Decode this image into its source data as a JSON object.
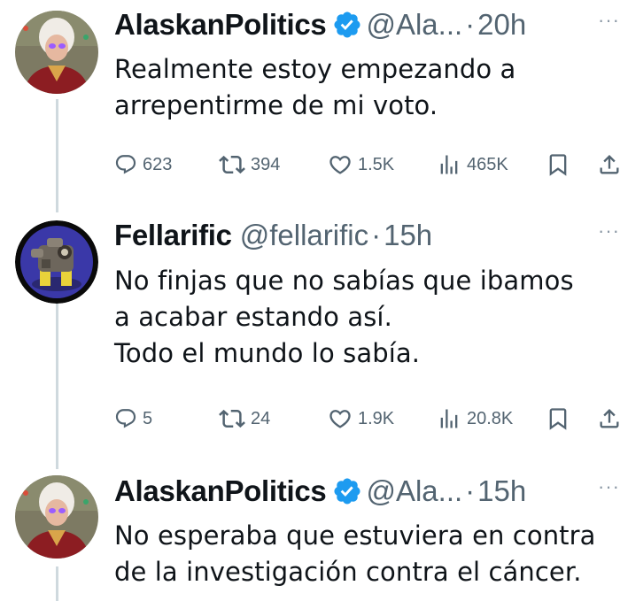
{
  "tweets": [
    {
      "name": "AlaskanPolitics",
      "verified": true,
      "handle": "@Ala...",
      "dot": "·",
      "time": "20h",
      "more": "···",
      "lines": [
        "Realmente estoy empezando a",
        "arrepentirme de mi voto."
      ],
      "replies": "623",
      "retweets": "394",
      "likes": "1.5K",
      "views": "465K"
    },
    {
      "name": "Fellarific",
      "verified": false,
      "handle": "@fellarific",
      "dot": "·",
      "time": "15h",
      "more": "···",
      "lines": [
        "No finjas que no sabías que ibamos",
        "a acabar estando así.",
        "Todo el mundo lo sabía."
      ],
      "replies": "5",
      "retweets": "24",
      "likes": "1.9K",
      "views": "20.8K"
    },
    {
      "name": "AlaskanPolitics",
      "verified": true,
      "handle": "@Ala...",
      "dot": "·",
      "time": "15h",
      "more": "···",
      "lines": [
        "No esperaba que estuviera en contra",
        "de la investigación contra el cáncer."
      ]
    }
  ],
  "icons": {
    "reply": "reply-icon",
    "retweet": "retweet-icon",
    "like": "like-icon",
    "views": "views-icon",
    "bookmark": "bookmark-icon",
    "share": "share-icon",
    "verified": "verified-badge-icon"
  },
  "colors": {
    "text": "#0f1419",
    "secondary": "#536471",
    "verified": "#1d9bf0",
    "thread_line": "#cfd9de"
  }
}
